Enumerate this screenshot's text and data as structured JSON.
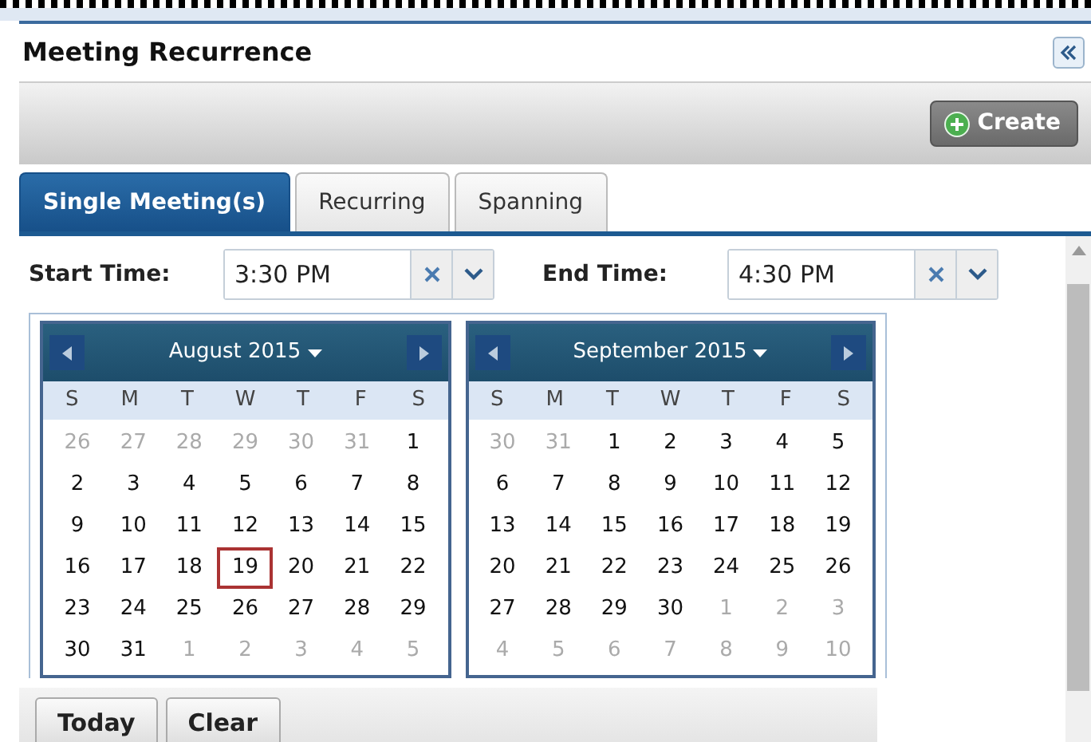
{
  "panel": {
    "title": "Meeting Recurrence",
    "create_label": "Create"
  },
  "tabs": [
    {
      "label": "Single Meeting(s)",
      "selected": true
    },
    {
      "label": "Recurring",
      "selected": false
    },
    {
      "label": "Spanning",
      "selected": false
    }
  ],
  "fields": [
    {
      "label": "Start Time:",
      "value": "3:30 PM"
    },
    {
      "label": "End Time:",
      "value": "4:30 PM"
    }
  ],
  "calendars": [
    {
      "title": "August 2015",
      "weekdays": [
        "S",
        "M",
        "T",
        "W",
        "T",
        "F",
        "S"
      ],
      "weeks": [
        [
          {
            "d": "26",
            "outside": true,
            "selected": false
          },
          {
            "d": "27",
            "outside": true,
            "selected": false
          },
          {
            "d": "28",
            "outside": true,
            "selected": false
          },
          {
            "d": "29",
            "outside": true,
            "selected": false
          },
          {
            "d": "30",
            "outside": true,
            "selected": false
          },
          {
            "d": "31",
            "outside": true,
            "selected": false
          },
          {
            "d": "1",
            "outside": false,
            "selected": false
          }
        ],
        [
          {
            "d": "2",
            "outside": false,
            "selected": false
          },
          {
            "d": "3",
            "outside": false,
            "selected": false
          },
          {
            "d": "4",
            "outside": false,
            "selected": false
          },
          {
            "d": "5",
            "outside": false,
            "selected": false
          },
          {
            "d": "6",
            "outside": false,
            "selected": false
          },
          {
            "d": "7",
            "outside": false,
            "selected": false
          },
          {
            "d": "8",
            "outside": false,
            "selected": false
          }
        ],
        [
          {
            "d": "9",
            "outside": false,
            "selected": false
          },
          {
            "d": "10",
            "outside": false,
            "selected": false
          },
          {
            "d": "11",
            "outside": false,
            "selected": false
          },
          {
            "d": "12",
            "outside": false,
            "selected": false
          },
          {
            "d": "13",
            "outside": false,
            "selected": false
          },
          {
            "d": "14",
            "outside": false,
            "selected": false
          },
          {
            "d": "15",
            "outside": false,
            "selected": false
          }
        ],
        [
          {
            "d": "16",
            "outside": false,
            "selected": false
          },
          {
            "d": "17",
            "outside": false,
            "selected": false
          },
          {
            "d": "18",
            "outside": false,
            "selected": false
          },
          {
            "d": "19",
            "outside": false,
            "selected": true
          },
          {
            "d": "20",
            "outside": false,
            "selected": false
          },
          {
            "d": "21",
            "outside": false,
            "selected": false
          },
          {
            "d": "22",
            "outside": false,
            "selected": false
          }
        ],
        [
          {
            "d": "23",
            "outside": false,
            "selected": false
          },
          {
            "d": "24",
            "outside": false,
            "selected": false
          },
          {
            "d": "25",
            "outside": false,
            "selected": false
          },
          {
            "d": "26",
            "outside": false,
            "selected": false
          },
          {
            "d": "27",
            "outside": false,
            "selected": false
          },
          {
            "d": "28",
            "outside": false,
            "selected": false
          },
          {
            "d": "29",
            "outside": false,
            "selected": false
          }
        ],
        [
          {
            "d": "30",
            "outside": false,
            "selected": false
          },
          {
            "d": "31",
            "outside": false,
            "selected": false
          },
          {
            "d": "1",
            "outside": true,
            "selected": false
          },
          {
            "d": "2",
            "outside": true,
            "selected": false
          },
          {
            "d": "3",
            "outside": true,
            "selected": false
          },
          {
            "d": "4",
            "outside": true,
            "selected": false
          },
          {
            "d": "5",
            "outside": true,
            "selected": false
          }
        ]
      ]
    },
    {
      "title": "September 2015",
      "weekdays": [
        "S",
        "M",
        "T",
        "W",
        "T",
        "F",
        "S"
      ],
      "weeks": [
        [
          {
            "d": "30",
            "outside": true,
            "selected": false
          },
          {
            "d": "31",
            "outside": true,
            "selected": false
          },
          {
            "d": "1",
            "outside": false,
            "selected": false
          },
          {
            "d": "2",
            "outside": false,
            "selected": false
          },
          {
            "d": "3",
            "outside": false,
            "selected": false
          },
          {
            "d": "4",
            "outside": false,
            "selected": false
          },
          {
            "d": "5",
            "outside": false,
            "selected": false
          }
        ],
        [
          {
            "d": "6",
            "outside": false,
            "selected": false
          },
          {
            "d": "7",
            "outside": false,
            "selected": false
          },
          {
            "d": "8",
            "outside": false,
            "selected": false
          },
          {
            "d": "9",
            "outside": false,
            "selected": false
          },
          {
            "d": "10",
            "outside": false,
            "selected": false
          },
          {
            "d": "11",
            "outside": false,
            "selected": false
          },
          {
            "d": "12",
            "outside": false,
            "selected": false
          }
        ],
        [
          {
            "d": "13",
            "outside": false,
            "selected": false
          },
          {
            "d": "14",
            "outside": false,
            "selected": false
          },
          {
            "d": "15",
            "outside": false,
            "selected": false
          },
          {
            "d": "16",
            "outside": false,
            "selected": false
          },
          {
            "d": "17",
            "outside": false,
            "selected": false
          },
          {
            "d": "18",
            "outside": false,
            "selected": false
          },
          {
            "d": "19",
            "outside": false,
            "selected": false
          }
        ],
        [
          {
            "d": "20",
            "outside": false,
            "selected": false
          },
          {
            "d": "21",
            "outside": false,
            "selected": false
          },
          {
            "d": "22",
            "outside": false,
            "selected": false
          },
          {
            "d": "23",
            "outside": false,
            "selected": false
          },
          {
            "d": "24",
            "outside": false,
            "selected": false
          },
          {
            "d": "25",
            "outside": false,
            "selected": false
          },
          {
            "d": "26",
            "outside": false,
            "selected": false
          }
        ],
        [
          {
            "d": "27",
            "outside": false,
            "selected": false
          },
          {
            "d": "28",
            "outside": false,
            "selected": false
          },
          {
            "d": "29",
            "outside": false,
            "selected": false
          },
          {
            "d": "30",
            "outside": false,
            "selected": false
          },
          {
            "d": "1",
            "outside": true,
            "selected": false
          },
          {
            "d": "2",
            "outside": true,
            "selected": false
          },
          {
            "d": "3",
            "outside": true,
            "selected": false
          }
        ],
        [
          {
            "d": "4",
            "outside": true,
            "selected": false
          },
          {
            "d": "5",
            "outside": true,
            "selected": false
          },
          {
            "d": "6",
            "outside": true,
            "selected": false
          },
          {
            "d": "7",
            "outside": true,
            "selected": false
          },
          {
            "d": "8",
            "outside": true,
            "selected": false
          },
          {
            "d": "9",
            "outside": true,
            "selected": false
          },
          {
            "d": "10",
            "outside": true,
            "selected": false
          }
        ]
      ]
    }
  ],
  "calendar_buttons": [
    "Today",
    "Clear"
  ]
}
